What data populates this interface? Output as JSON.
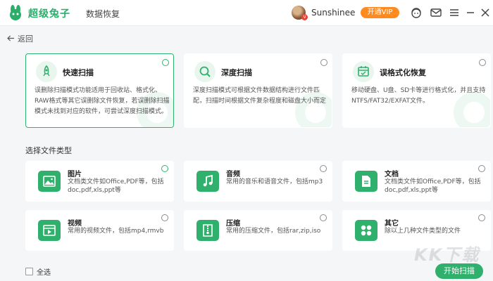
{
  "header": {
    "brand": "超级兔子",
    "app_name": "数据恢复",
    "username": "Sunshinee",
    "avatar_badge": "V",
    "vip_label": "开通VIP",
    "icons": [
      "support-icon",
      "message-icon",
      "menu-icon",
      "minimize-icon",
      "close-icon"
    ]
  },
  "back_label": "返回",
  "modes": [
    {
      "title": "快速扫描",
      "description": "误删除扫描模式功能适用于回收站、格式化、RAW格式等其它误删除文件恢复，若误删除扫描模式未找到对应的软件，可尝试深度扫描模式。",
      "selected": true,
      "icon": "rocket-icon"
    },
    {
      "title": "深度扫描",
      "description": "深度扫描模式可根据文件数据结构进行文件匹配，扫描时间根据文件复杂程度和磁盘大小而定",
      "selected": false,
      "icon": "magnifier-icon"
    },
    {
      "title": "误格式化恢复",
      "description": "移动硬盘、U盘、SD卡等进行格式化，并且支持NTFS/FAT32/EXFAT文件。",
      "selected": false,
      "icon": "calendar-restore-icon"
    }
  ],
  "file_type_section_title": "选择文件类型",
  "file_types": [
    {
      "title": "图片",
      "description": "文档类文件如Office,PDF等，包括doc,pdf,xls,ppt等",
      "selected": true,
      "icon": "image-icon"
    },
    {
      "title": "音频",
      "description": "常用的音乐和语音文件，包括mp3",
      "selected": false,
      "icon": "music-icon"
    },
    {
      "title": "文档",
      "description": "文档类文件如Office,PDF等，包括doc,pdf,xls,ppt等",
      "selected": false,
      "icon": "document-icon"
    },
    {
      "title": "视频",
      "description": "常用的视频文件，包括mp4,rmvb",
      "selected": false,
      "icon": "video-icon"
    },
    {
      "title": "压缩",
      "description": "常用的压缩文件，包括rar,zip,iso",
      "selected": false,
      "icon": "zip-icon"
    },
    {
      "title": "其它",
      "description": "除以上几种文件类型的文件",
      "selected": false,
      "icon": "grid-icon"
    }
  ],
  "select_all_label": "全选",
  "start_button_label": "开始扫描",
  "watermark_text": "KK下载",
  "colors": {
    "accent": "#2fb06d",
    "vip": "#ff8a1f",
    "background": "#f5f6f8"
  }
}
